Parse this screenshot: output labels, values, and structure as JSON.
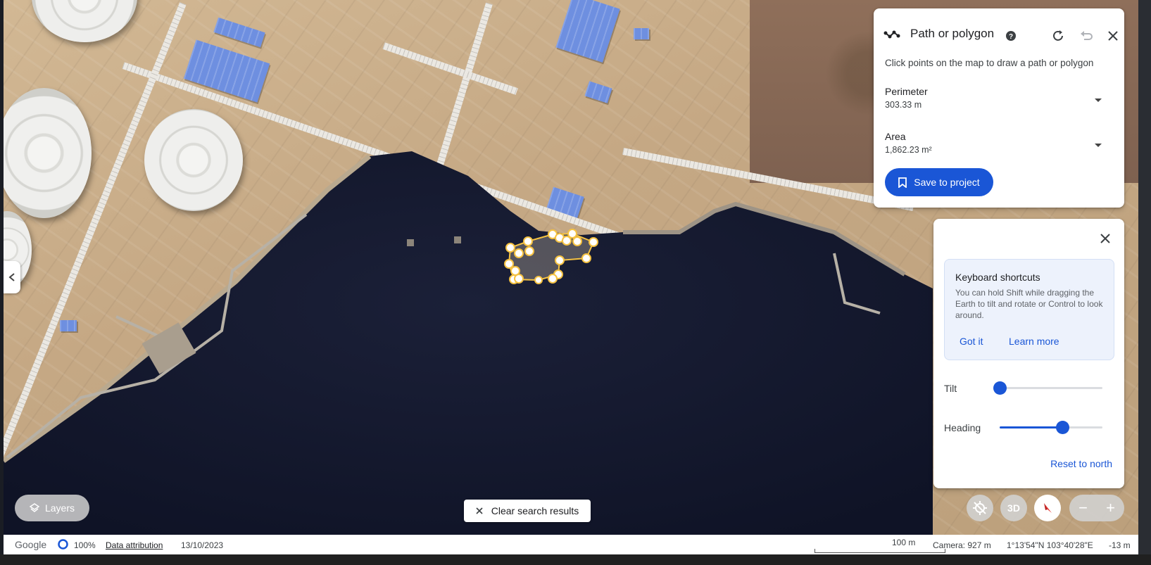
{
  "path_panel": {
    "title": "Path or polygon",
    "instructions": "Click points on the map to draw a path or polygon",
    "perimeter_label": "Perimeter",
    "perimeter_value": "303.33 m",
    "area_label": "Area",
    "area_value": "1,862.23 m²",
    "save_label": "Save to project"
  },
  "keyboard_panel": {
    "card_title": "Keyboard shortcuts",
    "card_text": "You can hold Shift while dragging the Earth to tilt and rotate or Control to look around.",
    "got_it": "Got it",
    "learn_more": "Learn more",
    "tilt_label": "Tilt",
    "tilt_value": 0.0,
    "heading_label": "Heading",
    "heading_value": 0.61,
    "reset_label": "Reset to north"
  },
  "map_controls": {
    "layers_label": "Layers",
    "clear_label": "Clear search results",
    "three_d_label": "3D"
  },
  "statusbar": {
    "brand": "Google",
    "percent": "100%",
    "attribution": "Data attribution",
    "date": "13/10/2023",
    "scale": "100 m",
    "camera": "Camera: 927 m",
    "coords": "1°13'54\"N 103°40'28\"E",
    "elevation": "-13 m"
  },
  "colors": {
    "accent": "#1a56d6",
    "water": "#14192e",
    "polygon_vertex": "#f5c242"
  }
}
